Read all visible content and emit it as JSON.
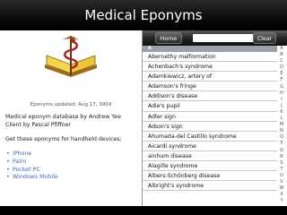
{
  "window": {
    "title": "Medical Eponyms"
  },
  "left": {
    "updated": "Eponyms updated: Aug 17, 3909",
    "description_line1": "Medical eponym database by Andrew Yee",
    "description_line2": "Client by Pascal Pfiffner",
    "get_heading": "Get these eponyms for handheld devices:",
    "links": [
      "iPhone",
      "Palm",
      "Pocket PC",
      "Windows Mobile"
    ]
  },
  "toolbar": {
    "home_label": "Home",
    "clear_label": "Clear",
    "search_value": ""
  },
  "list": {
    "section": "A",
    "items": [
      "Abernethy malformation",
      "Achenbach's syndrome",
      "Adamkiewicz, artery of",
      "Adamson's fringe",
      "Addison's disease",
      "Adie's pupil",
      "Adler sign",
      "Adson's sign",
      "Ahumada-del Castillo syndrome",
      "Aicardi syndrome",
      "ainhum disease",
      "Alagille syndrome",
      "Albers-Schönberg disease",
      "Albright's syndrome"
    ]
  },
  "alphabet": [
    "A",
    "B",
    "C",
    "D",
    "E",
    "F",
    "G",
    "H",
    "I",
    "J",
    "K",
    "L",
    "M",
    "N",
    "O",
    "P",
    "Q",
    "R",
    "S",
    "T",
    "U",
    "V",
    "W",
    "X",
    "Y",
    "Z",
    "#"
  ],
  "colors": {
    "link": "#3a6fc2",
    "section_header": "#9aa1aa",
    "titlebar": "#000000"
  },
  "icons": {
    "logo": "caduceus-book-icon"
  }
}
